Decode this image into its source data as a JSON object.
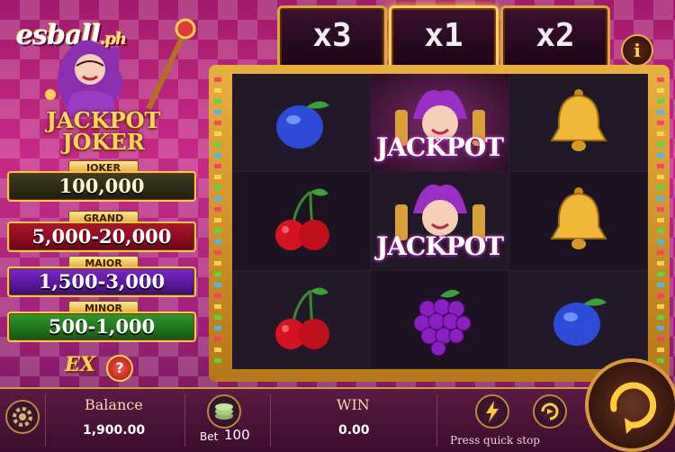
{
  "brand": {
    "logo": "esball",
    "logo_suffix": ".ph"
  },
  "game": {
    "title_line1": "JACKPOT",
    "title_line2": "JOKER"
  },
  "jackpots": [
    {
      "tier": "JOKER",
      "amount": "100,000"
    },
    {
      "tier": "GRAND",
      "amount": "5,000-20,000"
    },
    {
      "tier": "MAJOR",
      "amount": "1,500-3,000"
    },
    {
      "tier": "MINOR",
      "amount": "500-1,000"
    }
  ],
  "extra_button": {
    "label": "EX",
    "help": "?"
  },
  "multipliers": [
    {
      "label": "x3",
      "active": false
    },
    {
      "label": "x1",
      "active": true
    },
    {
      "label": "x2",
      "active": false
    }
  ],
  "info_button": "i",
  "reels": {
    "symbols": [
      [
        "plum-icon",
        "jackpot-joker-icon",
        "bell-icon"
      ],
      [
        "cherry-icon",
        "jackpot-joker-icon",
        "bell-icon"
      ],
      [
        "cherry-icon",
        "grapes-icon",
        "plum-icon"
      ]
    ],
    "jackpot_label": "JACKPOT"
  },
  "bottom_bar": {
    "balance_label": "Balance",
    "balance_value": "1,900.00",
    "bet_label": "Bet",
    "bet_value": "100",
    "win_label": "WIN",
    "win_value": "0.00",
    "quick_stop_hint": "Press quick stop"
  },
  "colors": {
    "frame_gold": "#e8b03e",
    "bg_magenta": "#c72a86"
  }
}
